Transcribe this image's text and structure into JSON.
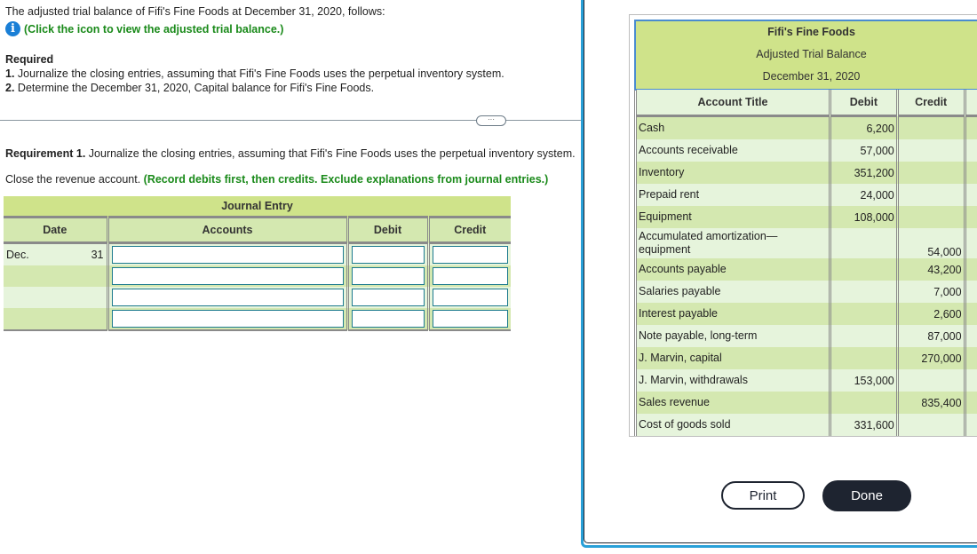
{
  "question": {
    "intro": "The adjusted trial balance of Fifi's Fine Foods at December 31, 2020, follows:",
    "info_link": "(Click the icon to view the adjusted trial balance.)",
    "info_icon": "info-icon",
    "required_title": "Required",
    "requirements": [
      {
        "num": "1.",
        "text": " Journalize the closing entries, assuming that Fifi's Fine Foods uses the perpetual inventory system."
      },
      {
        "num": "2.",
        "text": " Determine the December 31, 2020, Capital balance for Fifi's Fine Foods."
      }
    ],
    "more_button": "···",
    "requirement_heading_bold": "Requirement 1.",
    "requirement_heading_text": " Journalize the closing entries, assuming that Fifi's Fine Foods uses the perpetual inventory system.",
    "instruction": "Close the revenue account.",
    "instruction_note": " (Record debits first, then credits. Exclude explanations from journal entries.)"
  },
  "journal": {
    "title": "Journal Entry",
    "columns": [
      "Date",
      "Accounts",
      "Debit",
      "Credit"
    ],
    "rows": [
      {
        "month": "Dec.",
        "day": "31",
        "account": "",
        "debit": "",
        "credit": ""
      },
      {
        "month": "",
        "day": "",
        "account": "",
        "debit": "",
        "credit": ""
      },
      {
        "month": "",
        "day": "",
        "account": "",
        "debit": "",
        "credit": ""
      },
      {
        "month": "",
        "day": "",
        "account": "",
        "debit": "",
        "credit": ""
      }
    ]
  },
  "trial_balance": {
    "company": "Fifi's Fine Foods",
    "title": "Adjusted Trial Balance",
    "date": "December 31, 2020",
    "columns": [
      "Account Title",
      "Debit",
      "Credit"
    ],
    "rows": [
      {
        "title": "Cash",
        "debit": "6,200",
        "credit": ""
      },
      {
        "title": "Accounts receivable",
        "debit": "57,000",
        "credit": ""
      },
      {
        "title": "Inventory",
        "debit": "351,200",
        "credit": ""
      },
      {
        "title": "Prepaid rent",
        "debit": "24,000",
        "credit": ""
      },
      {
        "title": "Equipment",
        "debit": "108,000",
        "credit": ""
      },
      {
        "title": "Accumulated amortization— equipment",
        "debit": "",
        "credit": "54,000"
      },
      {
        "title": "Accounts payable",
        "debit": "",
        "credit": "43,200"
      },
      {
        "title": "Salaries payable",
        "debit": "",
        "credit": "7,000"
      },
      {
        "title": "Interest payable",
        "debit": "",
        "credit": "2,600"
      },
      {
        "title": "Note payable, long-term",
        "debit": "",
        "credit": "87,000"
      },
      {
        "title": "J. Marvin, capital",
        "debit": "",
        "credit": "270,000"
      },
      {
        "title": "J. Marvin, withdrawals",
        "debit": "153,000",
        "credit": ""
      },
      {
        "title": "Sales revenue",
        "debit": "",
        "credit": "835,400"
      },
      {
        "title": "Cost of goods sold",
        "debit": "331,600",
        "credit": ""
      }
    ]
  },
  "buttons": {
    "print": "Print",
    "done": "Done"
  }
}
